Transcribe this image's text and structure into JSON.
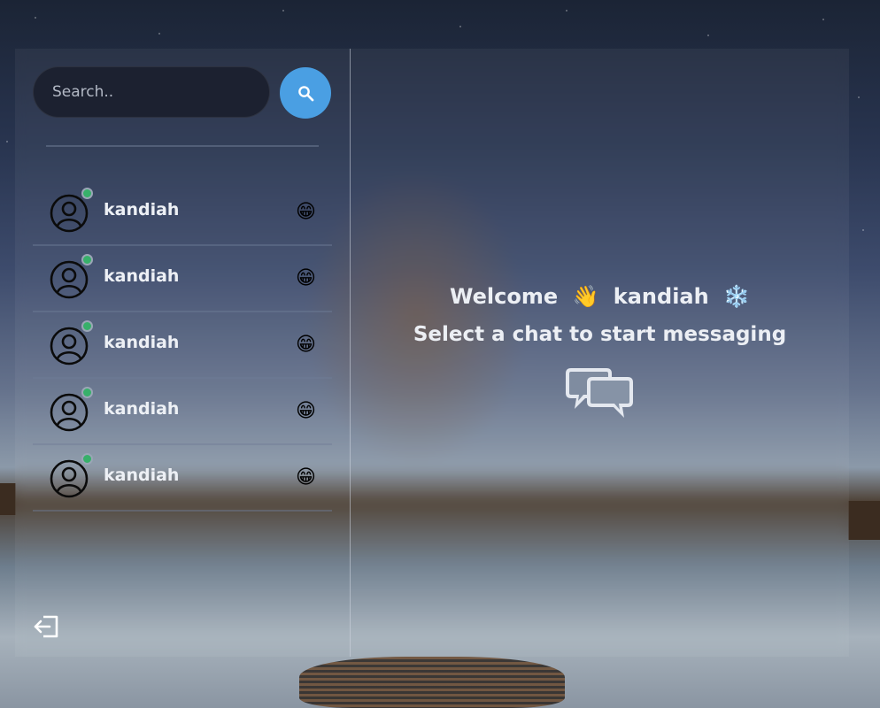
{
  "search": {
    "placeholder": "Search..",
    "button_icon": "search-icon",
    "button_color": "#4a9fe3"
  },
  "chats": [
    {
      "name": "kandiah",
      "emoji": "😁",
      "online": true
    },
    {
      "name": "kandiah",
      "emoji": "😁",
      "online": true
    },
    {
      "name": "kandiah",
      "emoji": "😁",
      "online": true
    },
    {
      "name": "kandiah",
      "emoji": "😁",
      "online": true
    },
    {
      "name": "kandiah",
      "emoji": "😁",
      "online": true
    }
  ],
  "welcome": {
    "greeting": "Welcome",
    "wave_emoji": "👋",
    "username": "kandiah",
    "snow_emoji": "❄️",
    "subtitle": "Select a chat to start messaging",
    "icon": "chat-bubbles-icon"
  },
  "footer": {
    "logout_icon": "logout-icon"
  },
  "colors": {
    "accent": "#4a9fe3",
    "online": "#37b06a"
  }
}
